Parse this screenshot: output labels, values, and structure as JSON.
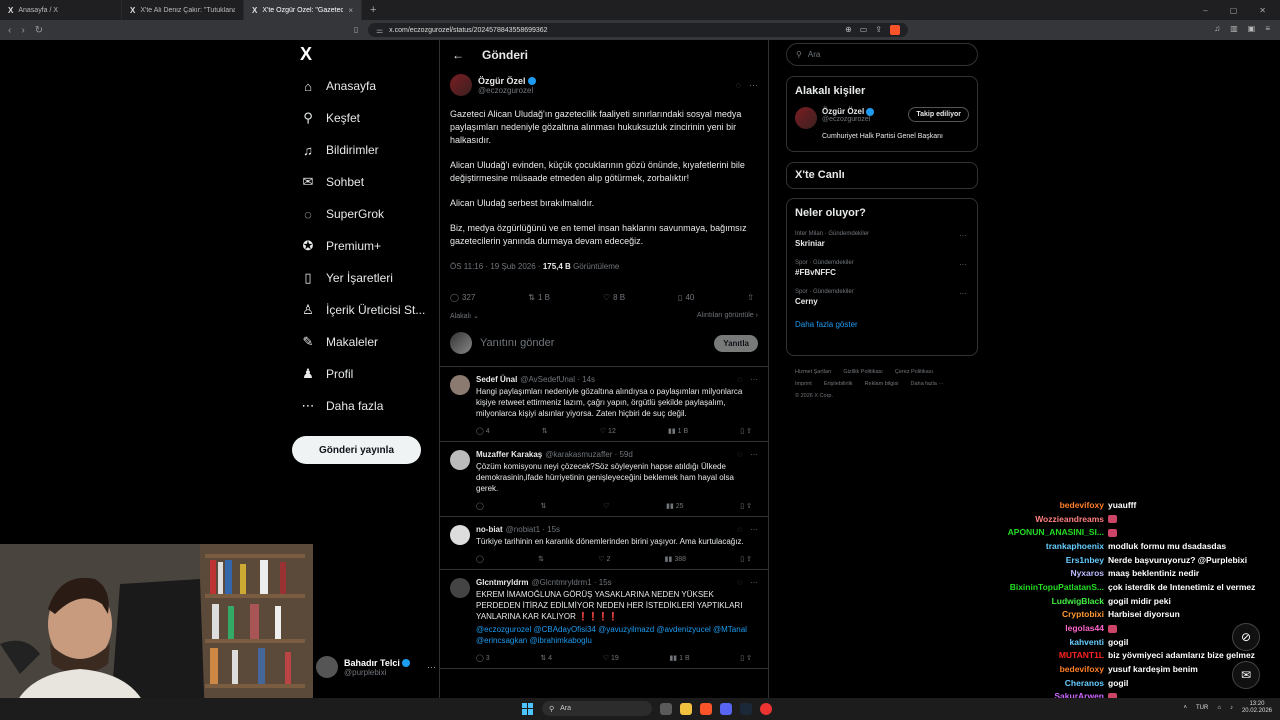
{
  "browser": {
    "tabs": [
      {
        "title": "Anasayfa / X",
        "active": false
      },
      {
        "title": "X'te Ali Deniz Çakır: \"Tutuklanan Gaz",
        "active": false
      },
      {
        "title": "X'te Özgür Özel: \"Gazeteci Alican",
        "active": true
      }
    ],
    "url": "x.com/eczozgurozel/status/2024578843558699362",
    "close_glyph": "×",
    "new_tab": "+"
  },
  "nav": {
    "logo": "X",
    "items": [
      {
        "label": "Anasayfa",
        "icon": "home-icon",
        "glyph": "⌂"
      },
      {
        "label": "Keşfet",
        "icon": "search-icon",
        "glyph": "⚲"
      },
      {
        "label": "Bildirimler",
        "icon": "bell-icon",
        "glyph": "♫"
      },
      {
        "label": "Sohbet",
        "icon": "mail-icon",
        "glyph": "✉"
      },
      {
        "label": "SuperGrok",
        "icon": "grok-icon",
        "glyph": "◌"
      },
      {
        "label": "Premium+",
        "icon": "premium-icon",
        "glyph": "✪"
      },
      {
        "label": "Yer İşaretleri",
        "icon": "bookmark-icon",
        "glyph": "▯"
      },
      {
        "label": "İçerik Üreticisi St...",
        "icon": "creator-icon",
        "glyph": "♙"
      },
      {
        "label": "Makaleler",
        "icon": "article-icon",
        "glyph": "✎"
      },
      {
        "label": "Profil",
        "icon": "profile-icon",
        "glyph": "♟"
      },
      {
        "label": "Daha fazla",
        "icon": "more-icon",
        "glyph": "⋯"
      }
    ],
    "post_button": "Gönderi yayınla",
    "account": {
      "name": "Bahadır Telci",
      "handle": "@purplebixi",
      "more": "···"
    }
  },
  "header": {
    "back": "←",
    "title": "Gönderi"
  },
  "main_tweet": {
    "name": "Özgür Özel",
    "handle": "@eczozgurozel",
    "paragraphs": [
      "Gazeteci Alican Uludağ'ın gazetecilik faaliyeti sınırlarındaki sosyal medya paylaşımları nedeniyle gözaltına alınması hukuksuzluk zincirinin yeni bir halkasıdır.",
      "Alican Uludağ'ı evinden, küçük çocuklarının gözü önünde, kıyafetlerini bile değiştirmesine müsaade etmeden alıp götürmek, zorbalıktır!",
      "Alican Uludağ serbest bırakılmalıdır.",
      "Biz, medya özgürlüğünü ve en temel insan haklarını savunmaya, bağımsız gazetecilerin yanında durmaya devam edeceğiz."
    ],
    "time": "ÖS 11:16 · 19 Şub 2026 · ",
    "views": "175,4 B",
    "views_label": " Görüntüleme",
    "replies": "327",
    "retweets": "1 B",
    "likes": "8 B",
    "bookmarks": "40",
    "related": "Alakalı",
    "quotes": "Alıntıları görüntüle",
    "reply_placeholder": "Yanıtını gönder",
    "reply_button": "Yanıtla"
  },
  "replies": [
    {
      "name": "Sedef Ünal",
      "handle": "@AvSedefUnal · 14s",
      "text": "Hangi paylaşımları nedeniyle gözaltına alındıysa o paylaşımları milyonlarca kişiye retweet ettirmeniz lazım, çağrı yapın, örgütlü şekilde paylaşalım, milyonlarca kişiyi alsınlar yiyorsa. Zaten hiçbiri de suç değil.",
      "mentions": "",
      "c": "4",
      "rt": "",
      "l": "12",
      "v": "1 B"
    },
    {
      "name": "Muzaffer Karakaş",
      "handle": "@karakasmuzaffer · 59d",
      "text": "Çözüm komisyonu neyi çözecek?Söz söyleyenin hapse atıldığı Ülkede demokrasinin,ifade hürriyetinin genişleyeceğini beklemek ham hayal olsa gerek.",
      "mentions": "",
      "c": "",
      "rt": "",
      "l": "",
      "v": "25"
    },
    {
      "name": "no-biat",
      "handle": "@nobiat1 · 15s",
      "text": "Türkiye tarihinin en karanlık dönemlerinden birini yaşıyor. Ama kurtulacağız.",
      "mentions": "",
      "c": "",
      "rt": "",
      "l": "2",
      "v": "388"
    },
    {
      "name": "Glcntmryldrm",
      "handle": "@Glcntmryldrm1 · 15s",
      "text": "EKREM İMAMOĞLUNA GÖRÜŞ YASAKLARINA NEDEN YÜKSEK PERDEDEN İTİRAZ EDİLMİYOR NEDEN HER İSTEDİKLERİ YAPTIKLARI YANLARINA KAR KALIYOR ❗❗❗❗",
      "mentions": "@eczozgurozel @CBAdayOfisi34 @yavuzyilmazd @avdenizyucel @MTanal @erincsagkan @ibrahimkaboglu",
      "c": "3",
      "rt": "4",
      "l": "19",
      "v": "1 B"
    }
  ],
  "right": {
    "search_placeholder": "Ara",
    "people_title": "Alakalı kişiler",
    "person": {
      "name": "Özgür Özel",
      "handle": "@eczozgurozel",
      "follow": "Takip ediliyor",
      "bio": "Cumhuriyet Halk Partisi Genel Başkanı"
    },
    "live_title": "X'te Canlı",
    "trends_title": "Neler oluyor?",
    "trends": [
      {
        "category": "Inter Milan · Gündemdekiler",
        "topic": "Skriniar"
      },
      {
        "category": "Spor · Gündemdekiler",
        "topic": "#FBvNFFC"
      },
      {
        "category": "Spor · Gündemdekiler",
        "topic": "Cerny"
      }
    ],
    "show_more": "Daha fazla göster",
    "footer_lines": [
      [
        "Hizmet Şartları",
        "Gizlilik Politikası",
        "Çerez Politikası"
      ],
      [
        "Imprint",
        "Erişilebilirlik",
        "Reklam bilgisi",
        "Daha fazla ···"
      ],
      [
        "© 2026 X Corp."
      ]
    ]
  },
  "chat": [
    {
      "user": "bedevifoxy",
      "color": "#ff7f27",
      "msg": "yuaufff",
      "emote": false
    },
    {
      "user": "Wozzieandreams",
      "color": "#ff7f7f",
      "msg": "",
      "emote": true
    },
    {
      "user": "APONUN_ANASINI_SI...",
      "color": "#22dd22",
      "msg": "",
      "emote": true
    },
    {
      "user": "trankaphoenix",
      "color": "#66ccff",
      "msg": "modluk formu mu dsadasdas",
      "emote": false
    },
    {
      "user": "Ers1nbey",
      "color": "#66ccff",
      "msg": "Nerde başvuruyoruz? @Purplebixi",
      "emote": false
    },
    {
      "user": "Nyxaros",
      "color": "#bbbbff",
      "msg": "maaş beklentiniz nedir",
      "emote": false
    },
    {
      "user": "BixininTopuPatlatanS...",
      "color": "#22dd22",
      "msg": "çok isterdik de Intenetimiz el vermez",
      "emote": false
    },
    {
      "user": "LudwigBlack",
      "color": "#44ee44",
      "msg": "gogil midir peki",
      "emote": false
    },
    {
      "user": "Cryptobixi",
      "color": "#ff9933",
      "msg": "Harbisei diyorsun",
      "emote": false
    },
    {
      "user": "legolas44",
      "color": "#ff66cc",
      "msg": "",
      "emote": true
    },
    {
      "user": "kahventi",
      "color": "#66ccff",
      "msg": "gogil",
      "emote": false
    },
    {
      "user": "MUTANT1L",
      "color": "#ff2222",
      "msg": "biz yövmiyeci adamlarız bize gelmez",
      "emote": false
    },
    {
      "user": "bedevifoxy",
      "color": "#ff7f27",
      "msg": "yusuf kardeşim benim",
      "emote": false
    },
    {
      "user": "Cheranos",
      "color": "#66ccff",
      "msg": "gogil",
      "emote": false
    },
    {
      "user": "SakurArwen",
      "color": "#cc66ff",
      "msg": "",
      "emote": true
    }
  ],
  "taskbar": {
    "search": "Ara",
    "lang": "TUR",
    "time": "13:20",
    "date": "20.02.2026"
  }
}
